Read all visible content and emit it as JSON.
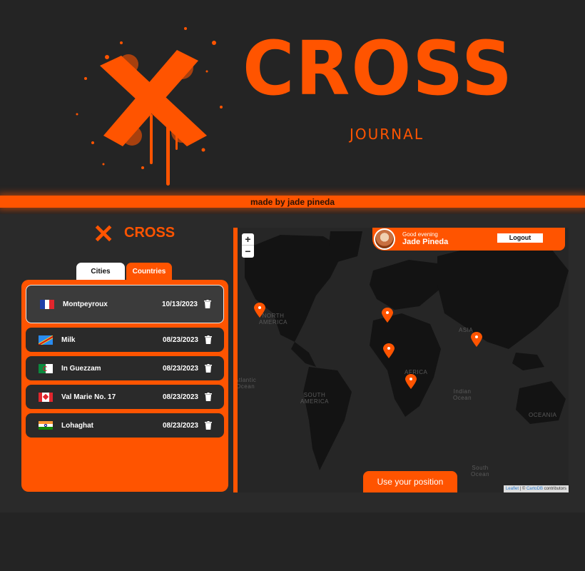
{
  "hero": {
    "title": "CROSS",
    "subtitle": "JOURNAL"
  },
  "banner": {
    "text": "made by jade pineda"
  },
  "sidebar": {
    "logo_text": "CROSS",
    "tabs": [
      {
        "label": "Cities",
        "active": true
      },
      {
        "label": "Countries",
        "active": false
      }
    ],
    "cities": [
      {
        "flag": "france-flag",
        "name": "Montpeyroux",
        "date": "10/13/2023",
        "selected": true
      },
      {
        "flag": "dr-congo-flag",
        "name": "Milk",
        "date": "08/23/2023",
        "selected": false
      },
      {
        "flag": "algeria-flag",
        "name": "In Guezzam",
        "date": "08/23/2023",
        "selected": false
      },
      {
        "flag": "canada-flag",
        "name": "Val Marie No. 17",
        "date": "08/23/2023",
        "selected": false
      },
      {
        "flag": "india-flag",
        "name": "Lohaghat",
        "date": "08/23/2023",
        "selected": false
      }
    ]
  },
  "map": {
    "zoom_in": "+",
    "zoom_out": "−",
    "regions": {
      "north_america": "NORTH\nAMERICA",
      "asia": "ASIA",
      "africa": "AFRICA",
      "south_america": "SOUTH\nAMERICA",
      "indian_ocean": "Indian\nOcean",
      "oceania": "OCEANIA",
      "south_ocean": "South\nOcean",
      "atlantic_ocean": "Atlantic\nOcean"
    },
    "greeting": {
      "line1": "Good evening",
      "name": "Jade Pineda",
      "logout_label": "Logout"
    },
    "use_position_label": "Use your position",
    "attribution": {
      "leaflet": "Leaflet",
      "sep": " | © ",
      "carto": "CartoDB",
      "rest": " contributors"
    }
  },
  "colors": {
    "accent": "#ff5400",
    "background": "#242424",
    "card": "#2a2a2a"
  }
}
